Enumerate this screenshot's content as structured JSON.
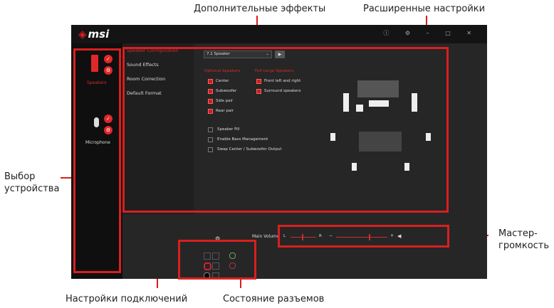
{
  "callouts": {
    "additional_effects": "Дополнительные эффекты",
    "advanced_settings": "Расширенные настройки",
    "device_select": "Выбор\nустройства",
    "master_volume": "Мастер-\nгромкость",
    "connection_settings": "Настройки подключений",
    "jack_status": "Состояние разъемов"
  },
  "app": {
    "logo": "msi",
    "devices": [
      {
        "label": "Speakers"
      },
      {
        "label": "Microphone"
      }
    ],
    "menu": [
      "Speaker Configuration",
      "Sound Effects",
      "Room Correction",
      "Default Format"
    ],
    "speaker_select": "7.1 Speaker",
    "optional_header": "Optional Speakers",
    "fullrange_header": "Full-range Speakers",
    "optional": [
      "Center",
      "Subwoofer",
      "Side pair",
      "Rear pair"
    ],
    "fullrange": [
      "Front left and right",
      "Surround speakers"
    ],
    "extras": [
      "Speaker Fill",
      "Enable Bass Management",
      "Swap Center / Subwoofer Output"
    ],
    "main_volume_label": "Main Volume",
    "balance_left": "L",
    "balance_right": "R",
    "vol_minus": "−",
    "vol_plus": "+"
  }
}
